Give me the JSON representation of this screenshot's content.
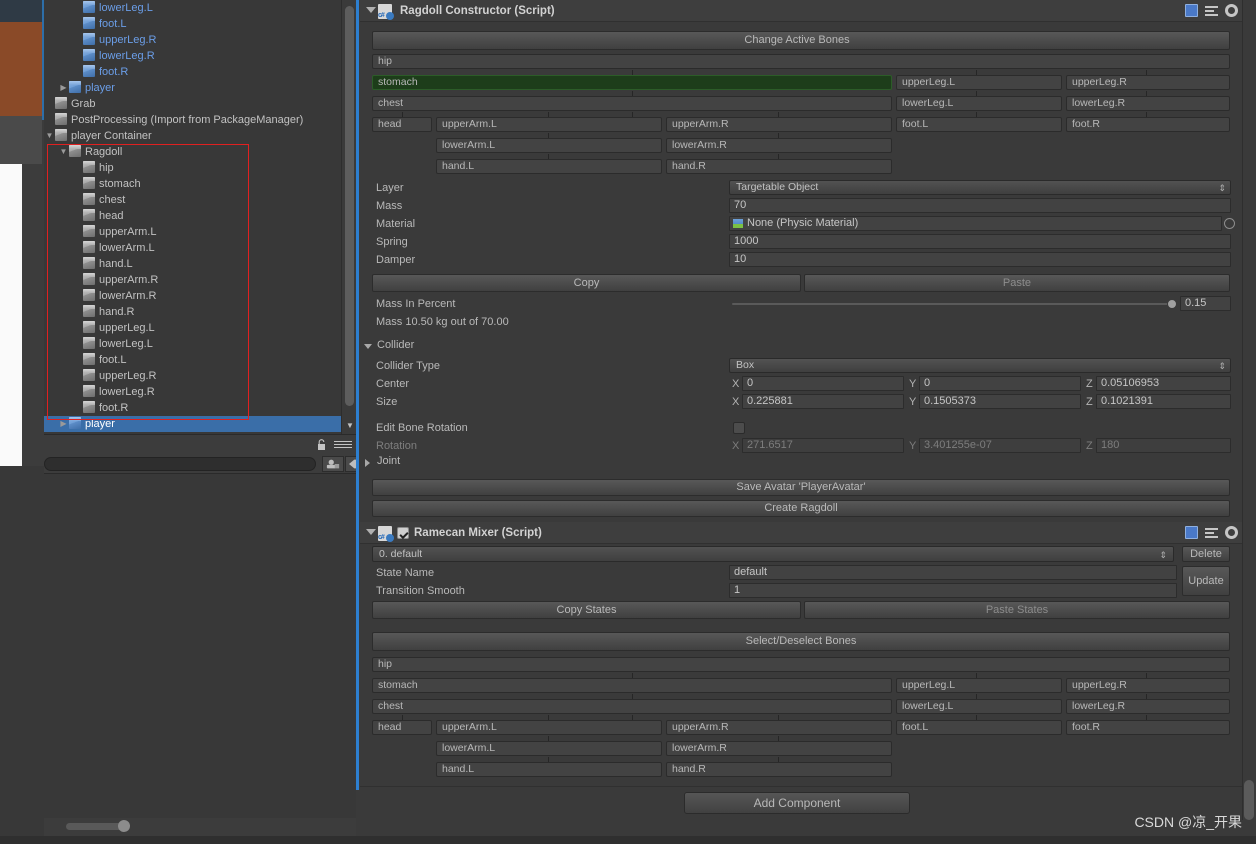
{
  "hierarchy": {
    "items": [
      {
        "label": "lowerLeg.L",
        "indent": 4,
        "prefab": true,
        "twisty": ""
      },
      {
        "label": "foot.L",
        "indent": 4,
        "prefab": true,
        "twisty": ""
      },
      {
        "label": "upperLeg.R",
        "indent": 4,
        "prefab": true,
        "twisty": ""
      },
      {
        "label": "lowerLeg.R",
        "indent": 4,
        "prefab": true,
        "twisty": ""
      },
      {
        "label": "foot.R",
        "indent": 4,
        "prefab": true,
        "twisty": ""
      },
      {
        "label": "player",
        "indent": 3,
        "prefab": true,
        "twisty": "right"
      },
      {
        "label": "Grab",
        "indent": 2,
        "prefab": false,
        "twisty": ""
      },
      {
        "label": "PostProcessing (Import from PackageManager)",
        "indent": 2,
        "prefab": false,
        "twisty": ""
      },
      {
        "label": "player Container",
        "indent": 2,
        "prefab": false,
        "twisty": "down"
      },
      {
        "label": "Ragdoll",
        "indent": 3,
        "prefab": false,
        "twisty": "down"
      },
      {
        "label": "hip",
        "indent": 4,
        "prefab": false,
        "twisty": ""
      },
      {
        "label": "stomach",
        "indent": 4,
        "prefab": false,
        "twisty": ""
      },
      {
        "label": "chest",
        "indent": 4,
        "prefab": false,
        "twisty": ""
      },
      {
        "label": "head",
        "indent": 4,
        "prefab": false,
        "twisty": ""
      },
      {
        "label": "upperArm.L",
        "indent": 4,
        "prefab": false,
        "twisty": ""
      },
      {
        "label": "lowerArm.L",
        "indent": 4,
        "prefab": false,
        "twisty": ""
      },
      {
        "label": "hand.L",
        "indent": 4,
        "prefab": false,
        "twisty": ""
      },
      {
        "label": "upperArm.R",
        "indent": 4,
        "prefab": false,
        "twisty": ""
      },
      {
        "label": "lowerArm.R",
        "indent": 4,
        "prefab": false,
        "twisty": ""
      },
      {
        "label": "hand.R",
        "indent": 4,
        "prefab": false,
        "twisty": ""
      },
      {
        "label": "upperLeg.L",
        "indent": 4,
        "prefab": false,
        "twisty": ""
      },
      {
        "label": "lowerLeg.L",
        "indent": 4,
        "prefab": false,
        "twisty": ""
      },
      {
        "label": "foot.L",
        "indent": 4,
        "prefab": false,
        "twisty": ""
      },
      {
        "label": "upperLeg.R",
        "indent": 4,
        "prefab": false,
        "twisty": ""
      },
      {
        "label": "lowerLeg.R",
        "indent": 4,
        "prefab": false,
        "twisty": ""
      },
      {
        "label": "foot.R",
        "indent": 4,
        "prefab": false,
        "twisty": ""
      },
      {
        "label": "player",
        "indent": 3,
        "prefab": true,
        "twisty": "right",
        "selected": true
      }
    ]
  },
  "ragdoll_constructor": {
    "title": "Ragdoll Constructor (Script)",
    "change_active_bones": "Change Active Bones",
    "bones": {
      "hip": "hip",
      "stomach": "stomach",
      "chest": "chest",
      "head": "head",
      "upperArm_L": "upperArm.L",
      "lowerArm_L": "lowerArm.L",
      "hand_L": "hand.L",
      "upperArm_R": "upperArm.R",
      "lowerArm_R": "lowerArm.R",
      "hand_R": "hand.R",
      "upperLeg_L": "upperLeg.L",
      "lowerLeg_L": "lowerLeg.L",
      "foot_L": "foot.L",
      "upperLeg_R": "upperLeg.R",
      "lowerLeg_R": "lowerLeg.R",
      "foot_R": "foot.R"
    },
    "props": {
      "layer_label": "Layer",
      "layer_value": "Targetable Object",
      "mass_label": "Mass",
      "mass_value": "70",
      "material_label": "Material",
      "material_value": "None (Physic Material)",
      "spring_label": "Spring",
      "spring_value": "1000",
      "damper_label": "Damper",
      "damper_value": "10"
    },
    "copy_label": "Copy",
    "paste_label": "Paste",
    "mass_in_percent_label": "Mass In Percent",
    "mass_in_percent_value": "0.15",
    "mass_summary": "Mass 10.50 kg out of 70.00",
    "collider": {
      "section_label": "Collider",
      "type_label": "Collider Type",
      "type_value": "Box",
      "center_label": "Center",
      "center_x": "0",
      "center_y": "0",
      "center_z": "0.05106953",
      "size_label": "Size",
      "size_x": "0.225881",
      "size_y": "0.1505373",
      "size_z": "0.1021391"
    },
    "edit_bone_rotation_label": "Edit Bone Rotation",
    "rotation_label": "Rotation",
    "rotation_x": "271.6517",
    "rotation_y": "3.401255e-07",
    "rotation_z": "180",
    "joint_label": "Joint",
    "save_avatar": "Save Avatar 'PlayerAvatar'",
    "create_ragdoll": "Create Ragdoll",
    "axis_x": "X",
    "axis_y": "Y",
    "axis_z": "Z"
  },
  "ramecan_mixer": {
    "title": "Ramecan Mixer (Script)",
    "state_dropdown": "0. default",
    "delete_label": "Delete",
    "update_label": "Update",
    "state_name_label": "State Name",
    "state_name_value": "default",
    "transition_smooth_label": "Transition Smooth",
    "transition_smooth_value": "1",
    "copy_states": "Copy States",
    "paste_states": "Paste States",
    "select_deselect_bones": "Select/Deselect Bones",
    "bones": {
      "hip": "hip",
      "stomach": "stomach",
      "chest": "chest",
      "head": "head",
      "upperArm_L": "upperArm.L",
      "lowerArm_L": "lowerArm.L",
      "hand_L": "hand.L",
      "upperArm_R": "upperArm.R",
      "lowerArm_R": "lowerArm.R",
      "hand_R": "hand.R",
      "upperLeg_L": "upperLeg.L",
      "lowerLeg_L": "lowerLeg.L",
      "foot_L": "foot.L",
      "upperLeg_R": "upperLeg.R",
      "lowerLeg_R": "lowerLeg.R",
      "foot_R": "foot.R"
    }
  },
  "add_component": "Add Component",
  "watermark": "CSDN @凉_开果",
  "colors": {
    "panel_bg": "#383838",
    "inspector_bg": "#3a3a3a",
    "accent_blue": "#2d7fd0",
    "selected_blue": "#3a6ea8",
    "highlight_green": "#1d3d1a",
    "redbox": "#e02020"
  }
}
